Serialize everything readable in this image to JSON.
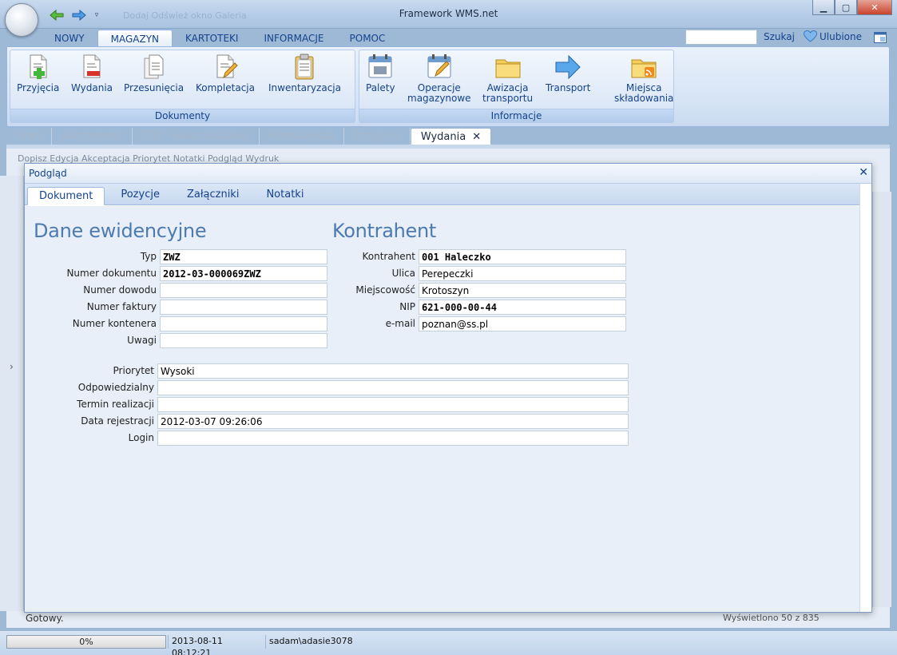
{
  "window": {
    "title": "Framework WMS.net",
    "quick_access_ghost": "Dodaj    Odśwież okno    Galeria"
  },
  "ribbon_tabs": [
    {
      "label": "NOWY"
    },
    {
      "label": "MAGAZYN"
    },
    {
      "label": "KARTOTEKI"
    },
    {
      "label": "INFORMACJE"
    },
    {
      "label": "POMOC"
    }
  ],
  "search": {
    "value": "",
    "label": "Szukaj"
  },
  "favorites": {
    "label": "Ulubione"
  },
  "ribbon": {
    "dokumenty": {
      "label": "Dokumenty",
      "buttons": [
        "Przyjęcia",
        "Wydania",
        "Przesunięcia",
        "Kompletacja",
        "Inwentaryzacja"
      ]
    },
    "informacje": {
      "label": "Informacje",
      "buttons": [
        {
          "l1": "Palety",
          "l2": ""
        },
        {
          "l1": "Operacje",
          "l2": "magazynowe"
        },
        {
          "l1": "Awizacja",
          "l2": "transportu"
        },
        {
          "l1": "Transport",
          "l2": ""
        },
        {
          "l1": "Miejsca",
          "l2": "składowania"
        }
      ]
    }
  },
  "doc_tabs": [
    {
      "label": "Start"
    },
    {
      "label": "Asortyment"
    },
    {
      "label": "ZPZ - awizo dostawy"
    },
    {
      "label": "Przesunięcia"
    },
    {
      "label": "Przyjęcia"
    },
    {
      "label": "Wydania"
    }
  ],
  "bg": {
    "toolbar_text": "Dopisz   Edycja   Akceptacja   Priorytet   Notatki   Podgląd   Wydruk",
    "status_left": "Gotowy.",
    "status_right": "Wyświetlono 50 z 835"
  },
  "modal": {
    "title": "Podgląd",
    "tabs": [
      {
        "label": "Dokument"
      },
      {
        "label": "Pozycje"
      },
      {
        "label": "Załączniki"
      },
      {
        "label": "Notatki"
      }
    ],
    "section_left": "Dane ewidencyjne",
    "section_right": "Kontrahent",
    "left_fields": [
      {
        "label": "Typ",
        "value": "ZWZ"
      },
      {
        "label": "Numer dokumentu",
        "value": "2012-03-000069ZWZ"
      },
      {
        "label": "Numer dowodu",
        "value": ""
      },
      {
        "label": "Numer faktury",
        "value": ""
      },
      {
        "label": "Numer kontenera",
        "value": ""
      },
      {
        "label": "Uwagi",
        "value": ""
      }
    ],
    "right_fields": [
      {
        "label": "Kontrahent",
        "value": "001 Haleczko"
      },
      {
        "label": "Ulica",
        "value": "Perepeczki"
      },
      {
        "label": "Miejscowość",
        "value": "Krotoszyn"
      },
      {
        "label": "NIP",
        "value": "621-000-00-44"
      },
      {
        "label": "e-mail",
        "value": "poznan@ss.pl"
      }
    ],
    "bottom_fields": [
      {
        "label": "Priorytet",
        "value": "Wysoki"
      },
      {
        "label": "Odpowiedzialny",
        "value": ""
      },
      {
        "label": "Termin realizacji",
        "value": ""
      },
      {
        "label": "Data rejestracji",
        "value": "2012-03-07 09:26:06"
      },
      {
        "label": "Login",
        "value": ""
      }
    ]
  },
  "statusbar": {
    "progress_text": "0%",
    "progress_value": 0,
    "datetime": "2013-08-11 08:12:21",
    "user": "sadam\\adasie3078"
  },
  "colors": {
    "accent": "#15428b",
    "section_title": "#4d7bb0",
    "ribbon_bg": "#d5e3f5"
  }
}
